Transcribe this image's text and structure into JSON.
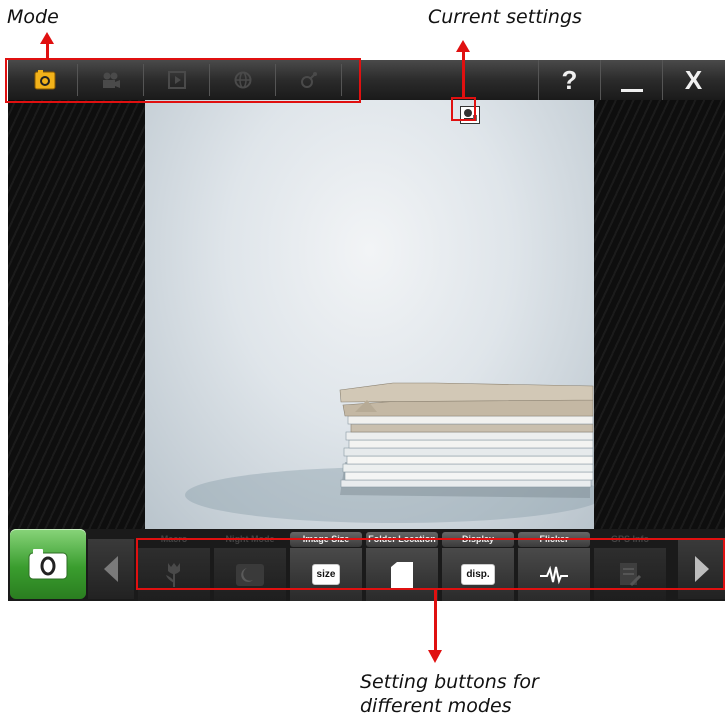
{
  "annotations": {
    "mode": "Mode",
    "current_settings": "Current settings",
    "settings_line1": "Setting buttons for",
    "settings_line2": "different modes"
  },
  "titlebar": {
    "help": "?",
    "minimize": "_",
    "close": "X",
    "modes": [
      "camera-icon",
      "video-icon",
      "playback-icon",
      "globe-icon",
      "satellite-icon"
    ]
  },
  "settings": [
    {
      "label": "Macro",
      "icon": "tulip-icon",
      "active": false
    },
    {
      "label": "Night Mode",
      "icon": "night-icon",
      "active": false
    },
    {
      "label": "Image Size",
      "icon": "size-icon",
      "chip": "size",
      "active": true
    },
    {
      "label": "Folder Location",
      "icon": "folder-icon",
      "active": true
    },
    {
      "label": "Display",
      "icon": "display-icon",
      "chip": "disp.",
      "active": true
    },
    {
      "label": "Flicker",
      "icon": "flicker-icon",
      "active": true
    },
    {
      "label": "GPS Info",
      "icon": "gps-info-icon",
      "active": false
    }
  ],
  "colors": {
    "accent_green": "#3a9d2e",
    "annotation_red": "#e01010",
    "mode_active": "#f2b21a"
  }
}
